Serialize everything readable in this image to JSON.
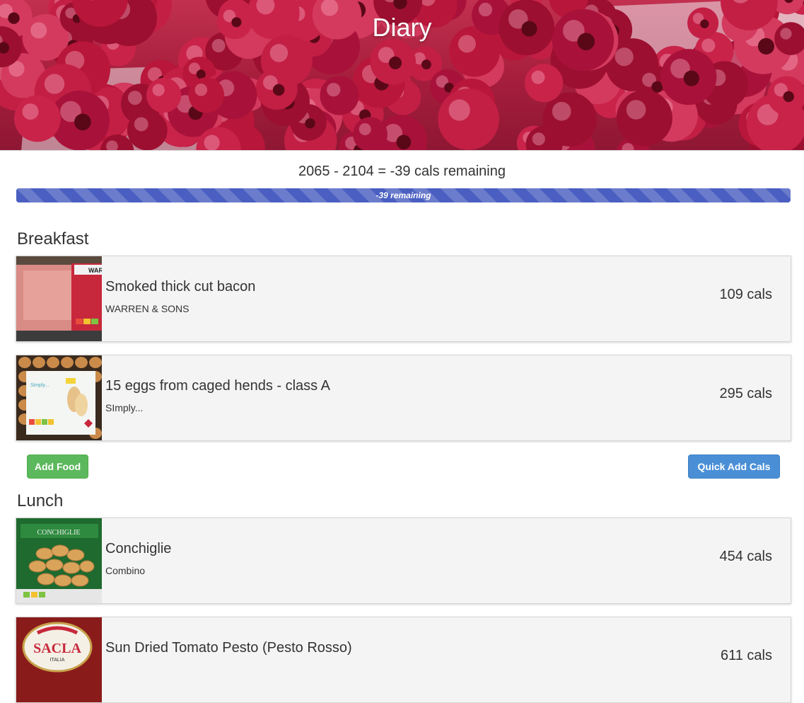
{
  "header": {
    "title": "Diary"
  },
  "summary": {
    "text": "2065 - 2104 = -39 cals remaining",
    "progress_label": "-39 remaining",
    "progress_fill": 1.0
  },
  "meals": [
    {
      "title": "Breakfast",
      "entries": [
        {
          "name": "Smoked thick cut bacon",
          "brand": "WARREN & SONS",
          "cals": "109 cals"
        },
        {
          "name": "15 eggs from caged hends - class A",
          "brand": "SImply...",
          "cals": "295 cals"
        }
      ],
      "add_food_label": "Add Food",
      "quick_add_label": "Quick Add Cals"
    },
    {
      "title": "Lunch",
      "entries": [
        {
          "name": "Conchiglie",
          "brand": "Combino",
          "cals": "454 cals"
        },
        {
          "name": "Sun Dried Tomato Pesto (Pesto Rosso)",
          "brand": "",
          "cals": "611 cals"
        }
      ]
    }
  ],
  "thumb_text": {
    "bacon_pack": "WAR",
    "eggs_pack": "Simply...",
    "pasta_pack": "CONCHIGLIE",
    "pesto_brand": "SACLA",
    "pesto_sub": "ITALIA"
  },
  "colors": {
    "progress": "#4a5fc1",
    "add_food": "#5cb85c",
    "quick_add": "#4a8fd6"
  }
}
